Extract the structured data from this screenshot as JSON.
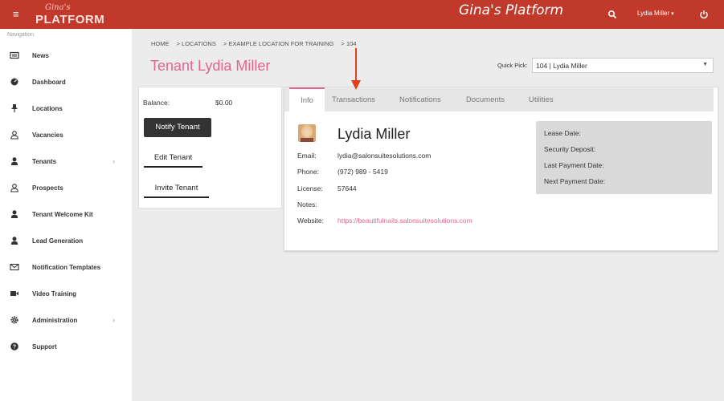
{
  "topbar": {
    "menu_glyph": "≡",
    "logo_script": "Gina's",
    "logo_brand": "PLATFORM",
    "app_title": "Gina's Platform",
    "user_name": "Lydia Miller",
    "user_caret": "▾",
    "search_icon": "search-icon",
    "power_icon": "power-icon"
  },
  "sidebar": {
    "heading": "Navigation",
    "chevron_glyph": "›",
    "items": [
      {
        "label": "News",
        "icon": "newspaper-icon"
      },
      {
        "label": "Dashboard",
        "icon": "dashboard-icon"
      },
      {
        "label": "Locations",
        "icon": "pin-icon"
      },
      {
        "label": "Vacancies",
        "icon": "user-outline-icon"
      },
      {
        "label": "Tenants",
        "icon": "user-icon",
        "has_chevron": true
      },
      {
        "label": "Prospects",
        "icon": "user-outline-icon"
      },
      {
        "label": "Tenant Welcome Kit",
        "icon": "user-icon"
      },
      {
        "label": "Lead Generation",
        "icon": "user-icon"
      },
      {
        "label": "Notification Templates",
        "icon": "envelope-icon"
      },
      {
        "label": "Video Training",
        "icon": "video-icon"
      },
      {
        "label": "Administration",
        "icon": "gear-icon",
        "has_chevron": true
      },
      {
        "label": "Support",
        "icon": "question-icon"
      }
    ]
  },
  "breadcrumb": [
    "HOME",
    "> LOCATIONS",
    "> EXAMPLE LOCATION FOR TRAINING",
    "> 104"
  ],
  "page_title": "Tenant Lydia Miller",
  "quick_pick": {
    "label": "Quick Pick:",
    "value": "104 | Lydia Miller",
    "arrow": "▼"
  },
  "left_card": {
    "balance_label": "Balance:",
    "balance_value": "$0.00",
    "notify_button": "Notify Tenant",
    "edit_button": "Edit Tenant",
    "invite_button": "Invite Tenant"
  },
  "tabs": [
    "Info",
    "Transactions",
    "Notifications",
    "Documents",
    "Utilities"
  ],
  "tenant": {
    "name": "Lydia Miller",
    "email_label": "Email:",
    "email": "lydia@salonsuitesolutions.com",
    "phone_label": "Phone:",
    "phone": "(972) 989 - 5419",
    "license_label": "License:",
    "license": "57644",
    "notes_label": "Notes:",
    "website_label": "Website:",
    "website": "https://beautifulnails.salonsuitesolutions.com"
  },
  "lease": {
    "lease_date": "Lease Date:",
    "security_deposit": "Security Deposit:",
    "last_payment": "Last Payment Date:",
    "next_payment": "Next Payment Date:"
  },
  "colors": {
    "topbar": "#c0392b",
    "accent_pink": "#e0668c",
    "annotation": "#e2401c"
  }
}
